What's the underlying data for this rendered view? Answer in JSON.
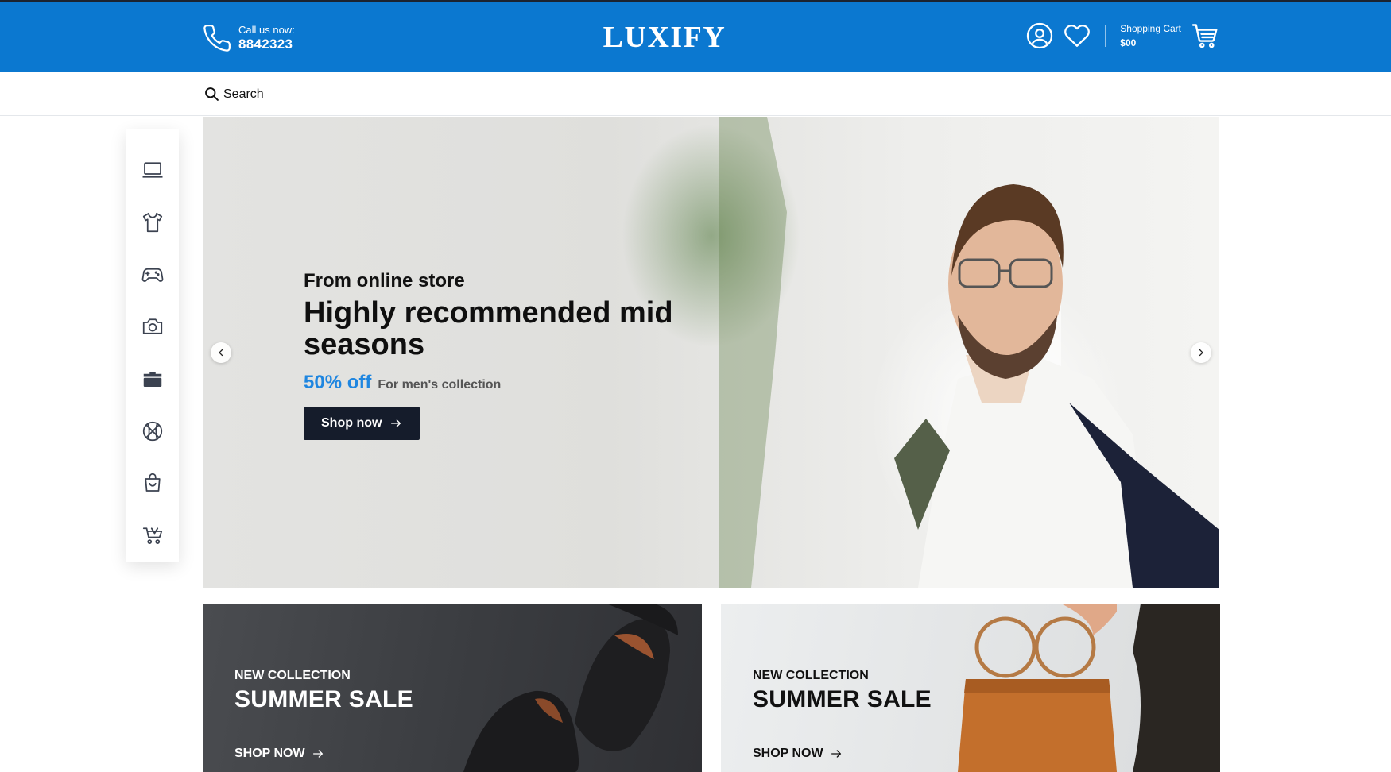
{
  "header": {
    "call_label": "Call us now:",
    "phone": "8842323",
    "brand": "LUXIFY",
    "cart_label": "Shopping Cart",
    "cart_amount": "$00"
  },
  "search": {
    "label": "Search"
  },
  "sidebar": {
    "icons": [
      "laptop-icon",
      "tshirt-icon",
      "gamepad-icon",
      "camera-icon",
      "toolbox-icon",
      "basketball-icon",
      "shopping-bag-icon",
      "stroller-icon"
    ]
  },
  "hero": {
    "subtitle": "From online store",
    "title": "Highly recommended mid seasons",
    "discount": "50% off",
    "discount_note": "For men's collection",
    "button": "Shop now"
  },
  "banners": [
    {
      "tag": "NEW COLLECTION",
      "title": "SUMMER SALE",
      "cta": "SHOP NOW"
    },
    {
      "tag": "NEW COLLECTION",
      "title": "SUMMER SALE",
      "cta": "SHOP NOW"
    }
  ],
  "colors": {
    "header_bg": "#0b78d0",
    "accent": "#1f86e0",
    "button_dark": "#151c2b"
  }
}
